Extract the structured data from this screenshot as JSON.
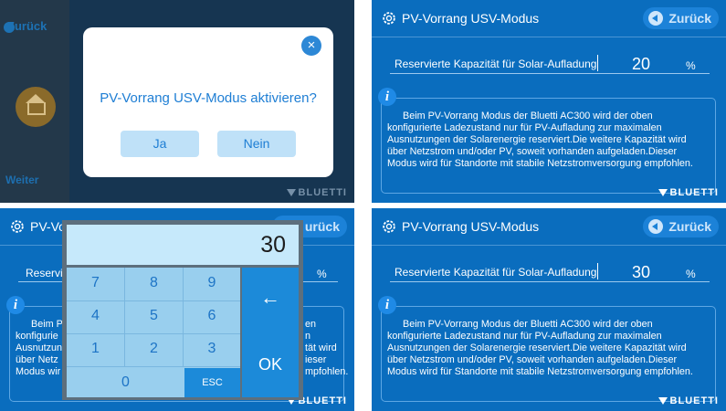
{
  "dialog_screen": {
    "back_label": "Zurück",
    "next_label": "Weiter",
    "question": "PV-Vorrang USV-Modus aktivieren?",
    "yes_label": "Ja",
    "no_label": "Nein",
    "close_icon": "×"
  },
  "screen": {
    "title": "PV-Vorrang USV-Modus",
    "back_label": "Zurück",
    "setting_label": "Reservierte Kapazität für Solar-Aufladung",
    "unit": "%",
    "info_icon": "i",
    "info_lines": [
      "Beim PV-Vorrang Modus der Bluetti AC300 wird der oben",
      "konfigurierte Ladezustand nur für PV-Aufladung zur maximalen",
      "Ausnutzungen der Solarenergie reserviert.Die weitere Kapazität wird",
      "über Netzstrom und/oder PV, soweit vorhanden aufgeladen.Dieser",
      "Modus wird für Standorte mit stabile Netzstromversorgung empfohlen."
    ],
    "brand": "BLUETTI"
  },
  "panel2": {
    "value": "20"
  },
  "panel4": {
    "value": "30"
  },
  "keypad": {
    "display_value": "30",
    "keys": [
      "7",
      "8",
      "9",
      "4",
      "5",
      "6",
      "1",
      "2",
      "3",
      "0"
    ],
    "esc_label": "ESC",
    "backspace_label": "←",
    "ok_label": "OK"
  },
  "panel3_partial": {
    "title_fragment": "PV-Vo",
    "back_fragment": "urück",
    "label_fragment": "Reservie",
    "unit": "%",
    "left_fragments": [
      "Beim PV",
      "konfigurie",
      "Ausnutzun",
      "über Netz",
      "Modus wir"
    ],
    "right_fragments": [
      "en",
      "n",
      "tät wird",
      "ieser",
      "mpfohlen."
    ]
  },
  "colors": {
    "screen_blue": "#0a6dbe",
    "dialog_text_blue": "#1e7ed4",
    "keypad_key_bg": "#99cfee",
    "keypad_accent": "#1c8ad9"
  },
  "icons": [
    "gear-icon",
    "back-arrow-icon",
    "info-icon",
    "home-icon",
    "close-icon",
    "backspace-icon",
    "bluetti-logo-icon"
  ]
}
